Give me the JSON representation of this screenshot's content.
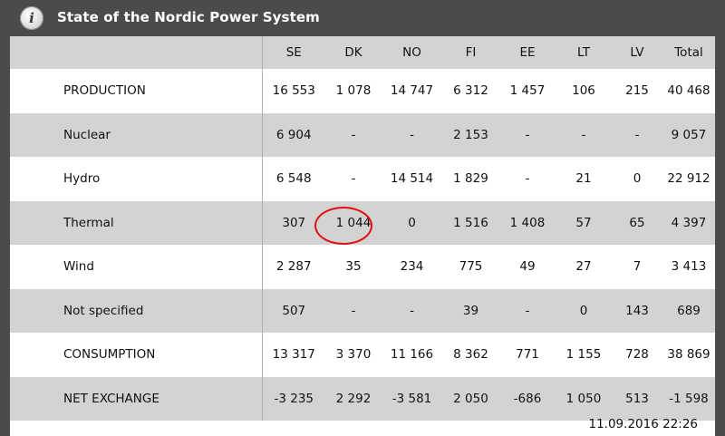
{
  "header": {
    "title": "State of the Nordic Power System",
    "icon": "info-icon"
  },
  "table": {
    "columns": [
      "SE",
      "DK",
      "NO",
      "FI",
      "EE",
      "LT",
      "LV",
      "Total"
    ],
    "rows": [
      {
        "label": "PRODUCTION",
        "values": [
          "16 553",
          "1 078",
          "14 747",
          "6 312",
          "1 457",
          "106",
          "215",
          "40 468"
        ]
      },
      {
        "label": "Nuclear",
        "values": [
          "6 904",
          "-",
          "-",
          "2 153",
          "-",
          "-",
          "-",
          "9 057"
        ]
      },
      {
        "label": "Hydro",
        "values": [
          "6 548",
          "-",
          "14 514",
          "1 829",
          "-",
          "21",
          "0",
          "22 912"
        ]
      },
      {
        "label": "Thermal",
        "values": [
          "307",
          "1 044",
          "0",
          "1 516",
          "1 408",
          "57",
          "65",
          "4 397"
        ]
      },
      {
        "label": "Wind",
        "values": [
          "2 287",
          "35",
          "234",
          "775",
          "49",
          "27",
          "7",
          "3 413"
        ]
      },
      {
        "label": "Not specified",
        "values": [
          "507",
          "-",
          "-",
          "39",
          "-",
          "0",
          "143",
          "689"
        ]
      },
      {
        "label": "CONSUMPTION",
        "values": [
          "13 317",
          "3 370",
          "11 166",
          "8 362",
          "771",
          "1 155",
          "728",
          "38 869"
        ]
      },
      {
        "label": "NET EXCHANGE",
        "values": [
          "-3 235",
          "2 292",
          "-3 581",
          "2 050",
          "-686",
          "1 050",
          "513",
          "-1 598"
        ]
      }
    ]
  },
  "timestamp": "11.09.2016 22:26",
  "highlight_color": "#e01010"
}
